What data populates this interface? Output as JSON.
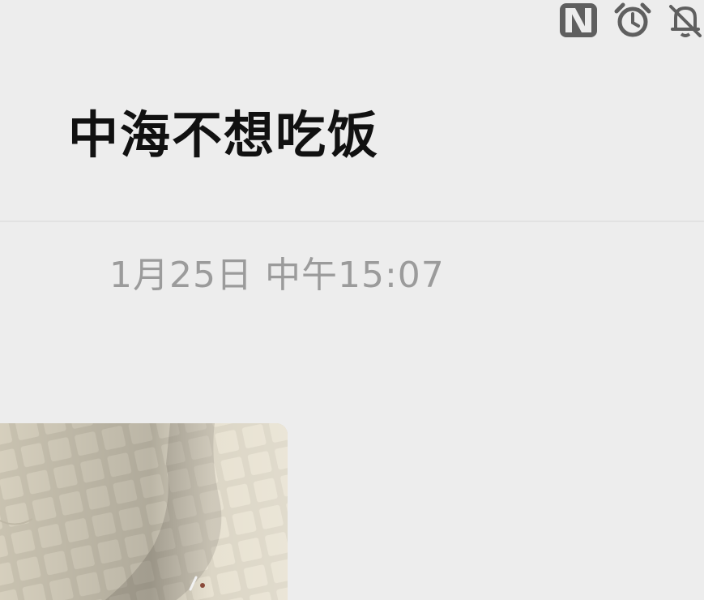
{
  "status_bar": {
    "icons": [
      "nfc-icon",
      "alarm-icon",
      "bell-off-icon"
    ]
  },
  "header": {
    "title": "中海不想吃饭"
  },
  "messages": [
    {
      "type": "timestamp",
      "text": "1月25日 中午15:07"
    },
    {
      "type": "image",
      "content": "photo of tiled floor"
    }
  ],
  "colors": {
    "background": "#ededed",
    "title": "#111111",
    "timestamp": "#9b9b9b"
  }
}
